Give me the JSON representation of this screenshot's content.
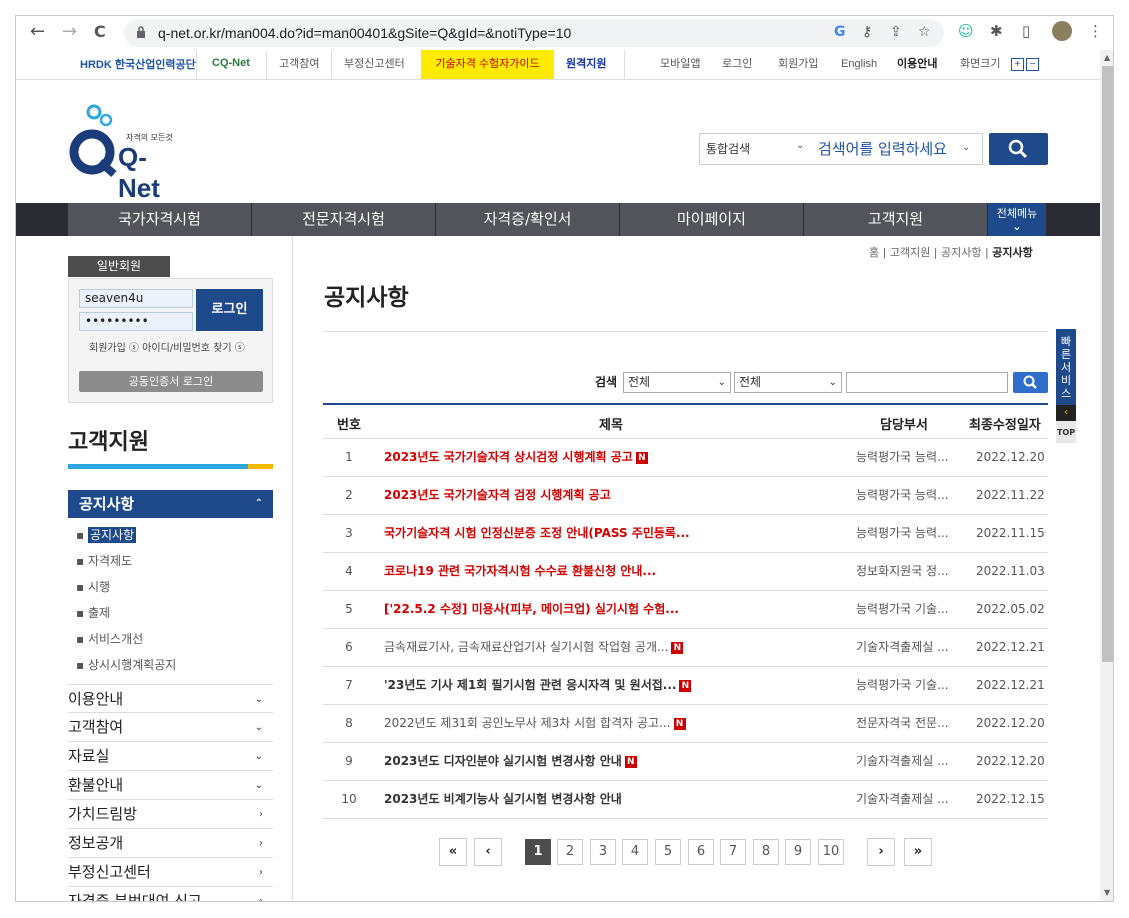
{
  "browser": {
    "url": "q-net.or.kr/man004.do?id=man00401&gSite=Q&gId=&notiType=10",
    "back": "←",
    "forward": "→",
    "reload": "C"
  },
  "util": {
    "hrdk": "HRDK 한국산업인력공단",
    "cqnet": "CQ-Net",
    "links": [
      "고객참여",
      "부정신고센터"
    ],
    "guide": "기술자격 수험자가이드",
    "remote": "원격지원",
    "right": [
      "모바일앱",
      "로그인",
      "회원가입",
      "English",
      "이용안내",
      "화면크기"
    ]
  },
  "logo": {
    "tagline": "자격의 모든것",
    "name": "Q-Net"
  },
  "search": {
    "scope": "통합검색",
    "placeholder": "검색어를 입력하세요"
  },
  "gnb": {
    "items": [
      "국가자격시험",
      "전문자격시험",
      "자격증/확인서",
      "마이페이지",
      "고객지원"
    ],
    "all": "전체메뉴"
  },
  "login": {
    "tab": "일반회원",
    "user": "seaven4u",
    "password": "•••••••••",
    "button": "로그인",
    "join": "회원가입",
    "find": "아이디/비밀번호 찾기",
    "cert": "공동인증서 로그인"
  },
  "lnb": {
    "title": "고객지원",
    "active": "공지사항",
    "subs": [
      "공지사항",
      "자격제도",
      "시행",
      "출제",
      "서비스개선",
      "상시시행계획공지"
    ],
    "items": [
      "이용안내",
      "고객참여",
      "자료실",
      "환불안내",
      "가치드림방",
      "정보공개",
      "부정신고센터",
      "자격증 부번대여 신고"
    ]
  },
  "breadcrumb": [
    "홈",
    "고객지원",
    "공지사항",
    "공지사항"
  ],
  "page": {
    "title": "공지사항"
  },
  "filter": {
    "label": "검색",
    "sel1": "전체",
    "sel2": "전체"
  },
  "table": {
    "headers": [
      "번호",
      "제목",
      "담당부서",
      "최종수정일자"
    ],
    "rows": [
      {
        "no": "1",
        "title": "2023년도 국가기술자격 상시검정 시행계획 공고",
        "dept": "능력평가국 능력...",
        "date": "2022.12.20"
      },
      {
        "no": "2",
        "title": "2023년도 국가기술자격 검정 시행계획 공고",
        "dept": "능력평가국 능력...",
        "date": "2022.11.22"
      },
      {
        "no": "3",
        "title": "국가기술자격 시험 인정신분증 조정 안내(PASS 주민등록...",
        "dept": "능력평가국 능력...",
        "date": "2022.11.15"
      },
      {
        "no": "4",
        "title": "코로나19 관련 국가자격시험 수수료 환불신청 안내...",
        "dept": "정보화지원국 정...",
        "date": "2022.11.03"
      },
      {
        "no": "5",
        "title": "['22.5.2 수정] 미용사(피부, 메이크업) 실기시험 수험...",
        "dept": "능력평가국 기술...",
        "date": "2022.05.02"
      },
      {
        "no": "6",
        "title": "금속재료기사, 금속재료산업기사 실기시험 작업형 공개...",
        "dept": "기술자격출제실 ...",
        "date": "2022.12.21"
      },
      {
        "no": "7",
        "title": "'23년도 기사 제1회 필기시험 관련 응시자격 및 원서접...",
        "dept": "능력평가국 기술...",
        "date": "2022.12.21"
      },
      {
        "no": "8",
        "title": "2022년도 제31회 공인노무사 제3차 시험 합격자 공고...",
        "dept": "전문자격국 전문...",
        "date": "2022.12.20"
      },
      {
        "no": "9",
        "title": "2023년도 디자인분야 실기시험 변경사항 안내",
        "dept": "기술자격출제실 ...",
        "date": "2022.12.20"
      },
      {
        "no": "10",
        "title": "2023년도 비계기능사 실기시험 변경사항 안내",
        "dept": "기술자격출제실 ...",
        "date": "2022.12.15"
      }
    ]
  },
  "pagination": {
    "pages": [
      "1",
      "2",
      "3",
      "4",
      "5",
      "6",
      "7",
      "8",
      "9",
      "10"
    ],
    "first": "«",
    "prev": "‹",
    "next": "›",
    "last": "»"
  },
  "quick": {
    "label": "빠른서비스",
    "top": "TOP"
  },
  "new_badge": "N"
}
